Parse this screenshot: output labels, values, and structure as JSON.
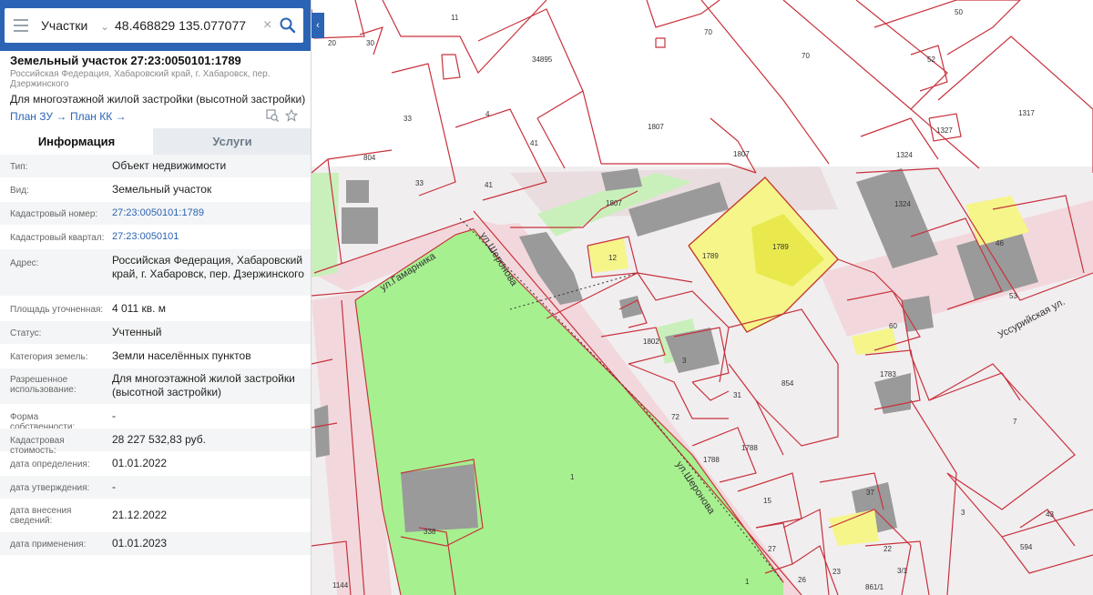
{
  "search": {
    "layer": "Участки",
    "query": "48.468829 135.077077"
  },
  "card": {
    "title": "Земельный участок 27:23:0050101:1789",
    "address_short": "Российская Федерация, Хабаровский край, г. Хабаровск, пер. Дзержинского",
    "purpose": "Для многоэтажной жилой застройки (высотной застройки)",
    "links": {
      "plan_zu": "План ЗУ →",
      "plan_kk": "План КК →"
    }
  },
  "tabs": {
    "info": "Информация",
    "services": "Услуги"
  },
  "rows": [
    {
      "label": "Тип:",
      "value": "Объект недвижимости"
    },
    {
      "label": "Вид:",
      "value": "Земельный участок"
    },
    {
      "label": "Кадастровый номер:",
      "value": "27:23:0050101:1789"
    },
    {
      "label": "Кадастровый квартал:",
      "value": "27:23:0050101"
    },
    {
      "label": "Адрес:",
      "value": "Российская Федерация, Хабаровский край, г. Хабаровск, пер. Дзержинского"
    },
    {
      "label": "Площадь уточненная:",
      "value": "4 011 кв. м"
    },
    {
      "label": "Статус:",
      "value": "Учтенный"
    },
    {
      "label": "Категория земель:",
      "value": "Земли населённых пунктов"
    },
    {
      "label": "Разрешенное использование:",
      "value": "Для многоэтажной жилой застройки (высотной застройки)"
    },
    {
      "label": "Форма собственности:",
      "value": "-"
    },
    {
      "label": "Кадастровая стоимость:",
      "value": "28 227 532,83 руб."
    },
    {
      "label": "дата определения:",
      "value": "01.01.2022"
    },
    {
      "label": "дата утверждения:",
      "value": "-"
    },
    {
      "label": "дата внесения сведений:",
      "value": "21.12.2022"
    },
    {
      "label": "дата применения:",
      "value": "01.01.2023"
    }
  ],
  "map": {
    "parcel_labels": [
      "20",
      "30",
      "11",
      "34895",
      "70",
      "70",
      "50",
      "52",
      "33",
      "4",
      "41",
      "1807",
      "1317",
      "1327",
      "804",
      "33",
      "41",
      "1324",
      "1807",
      "1807",
      "1324",
      "12",
      "1789",
      "1789",
      "46",
      "53",
      "60",
      "1802",
      "3",
      "31",
      "854",
      "1783",
      "72",
      "1788",
      "1788",
      "15",
      "7",
      "37",
      "3",
      "43",
      "1",
      "1",
      "338",
      "27",
      "26",
      "23",
      "22",
      "861/1",
      "1144",
      "3/1",
      "594"
    ],
    "street_labels": [
      "ул.Гамарника",
      "ул.Шеронова",
      "ул.Шеронова",
      "Уссурийская ул."
    ],
    "colors": {
      "boundary": "#c8323c",
      "park": "#a6f08f",
      "selected": "#f5f58a",
      "road": "#f2d8dc",
      "building": "#9a9a9a"
    }
  }
}
